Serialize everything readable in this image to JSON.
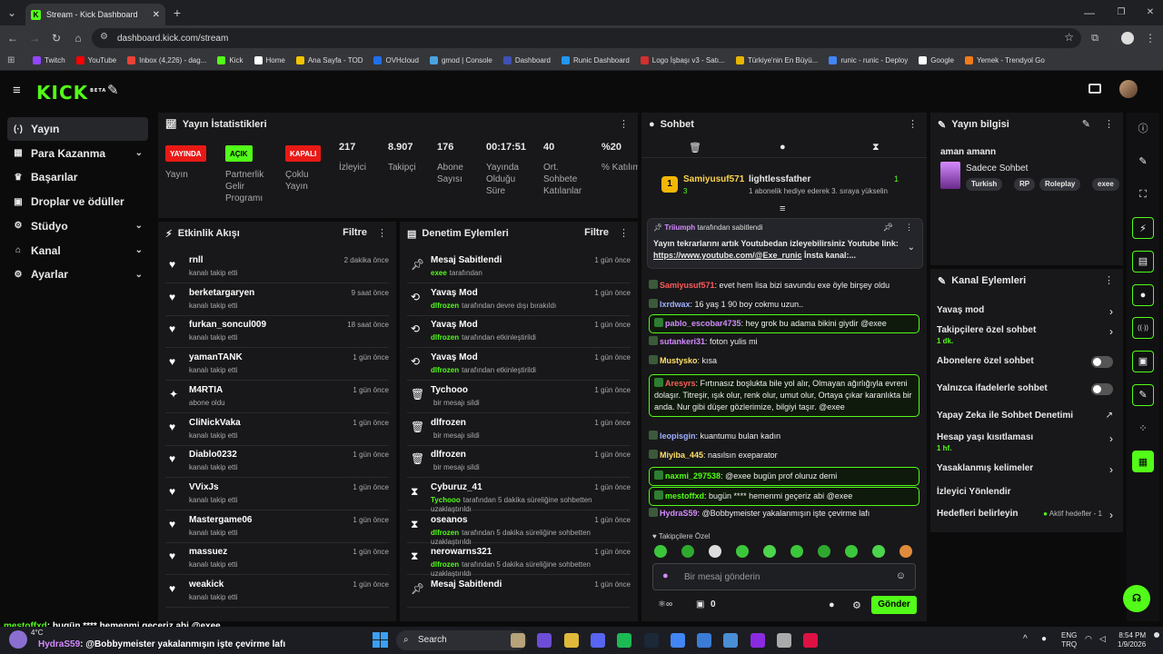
{
  "browser": {
    "tab_title": "Stream - Kick Dashboard",
    "url": "dashboard.kick.com/stream",
    "bookmarks": [
      "Twitch",
      "YouTube",
      "Inbox (4,226) - dag...",
      "Kick",
      "Home",
      "Ana Sayfa - TOD",
      "OVHcloud",
      "gmod | Console",
      "Dashboard",
      "Runic Dashboard",
      "Logo İşbaşı v3 - Satı...",
      "Türkiye'nin En Büyü...",
      "runic - runic - Deploy",
      "Google",
      "Yemek - Trendyol Go"
    ],
    "bookmark_colors": [
      "#9146ff",
      "#ff0000",
      "#ea4335",
      "#53fc18",
      "#ffffff",
      "#f5c400",
      "#1f6feb",
      "#4aa3df",
      "#3f51b5",
      "#2196f3",
      "#d32f2f",
      "#e8b600",
      "#4285f4",
      "#ffffff",
      "#f27a1a"
    ]
  },
  "header": {
    "logo": "KICK",
    "beta": "BETA"
  },
  "sidebar": {
    "items": [
      {
        "label": "Yayın",
        "icon": "stream-icon",
        "glyph": "(·)"
      },
      {
        "label": "Para Kazanma",
        "icon": "money-icon",
        "glyph": "▦"
      },
      {
        "label": "Başarılar",
        "icon": "trophy-icon",
        "glyph": "♛"
      },
      {
        "label": "Droplar ve ödüller",
        "icon": "gift-icon",
        "glyph": "▣"
      },
      {
        "label": "Stüdyo",
        "icon": "studio-icon",
        "glyph": "⚙"
      },
      {
        "label": "Kanal",
        "icon": "channel-icon",
        "glyph": "⌂"
      },
      {
        "label": "Ayarlar",
        "icon": "settings-icon",
        "glyph": "⚙"
      }
    ]
  },
  "stats": {
    "title": "Yayın İstatistikleri",
    "badges": [
      {
        "text": "YAYINDA",
        "label": "Yayın"
      },
      {
        "text": "AÇIK",
        "label": "Partnerlik Gelir Programı"
      },
      {
        "text": "KAPALI",
        "label": "Çoklu Yayın"
      }
    ],
    "items": [
      {
        "value": "217",
        "label": "İzleyici"
      },
      {
        "value": "8.907",
        "label": "Takipçi"
      },
      {
        "value": "176",
        "label": "Abone Sayısı"
      },
      {
        "value": "00:17:51",
        "label": "Yayında Olduğu Süre"
      },
      {
        "value": "40",
        "label": "Ort. Sohbete Katılanlar"
      },
      {
        "value": "%20",
        "label": "% Katılım"
      }
    ]
  },
  "activity": {
    "title": "Etkinlik Akışı",
    "filter": "Filtre",
    "items": [
      {
        "name": "rnll",
        "sub": "kanalı takip etti",
        "time": "2 dakika önce"
      },
      {
        "name": "berketargaryen",
        "sub": "kanalı takip etti",
        "time": "9 saat önce"
      },
      {
        "name": "furkan_soncul009",
        "sub": "kanalı takip etti",
        "time": "18 saat önce"
      },
      {
        "name": "yamanTANK",
        "sub": "kanalı takip etti",
        "time": "1 gün önce"
      },
      {
        "name": "M4RTIA",
        "sub": "abone oldu",
        "time": "1 gün önce"
      },
      {
        "name": "CliNickVaka",
        "sub": "kanalı takip etti",
        "time": "1 gün önce"
      },
      {
        "name": "Diablo0232",
        "sub": "kanalı takip etti",
        "time": "1 gün önce"
      },
      {
        "name": "VVixJs",
        "sub": "kanalı takip etti",
        "time": "1 gün önce"
      },
      {
        "name": "Mastergame06",
        "sub": "kanalı takip etti",
        "time": "1 gün önce"
      },
      {
        "name": "massuez",
        "sub": "kanalı takip etti",
        "time": "1 gün önce"
      },
      {
        "name": "weakick",
        "sub": "kanalı takip etti",
        "time": "1 gün önce"
      }
    ]
  },
  "moderation": {
    "title": "Denetim Eylemleri",
    "filter": "Filtre",
    "items": [
      {
        "name": "Mesaj Sabitlendi",
        "who": "exee",
        "sub": "tarafından",
        "time": "1 gün önce"
      },
      {
        "name": "Yavaş Mod",
        "who": "dlfrozen",
        "sub": "tarafından devre dışı bırakıldı",
        "time": "1 gün önce"
      },
      {
        "name": "Yavaş Mod",
        "who": "dlfrozen",
        "sub": "tarafından etkinleştirildi",
        "time": "1 gün önce"
      },
      {
        "name": "Yavaş Mod",
        "who": "dlfrozen",
        "sub": "tarafından etkinleştirildi",
        "time": "1 gün önce"
      },
      {
        "name": "Tychooo",
        "who": "",
        "sub": "bir mesajı sildi",
        "time": "1 gün önce"
      },
      {
        "name": "dlfrozen",
        "who": "",
        "sub": "bir mesajı sildi",
        "time": "1 gün önce"
      },
      {
        "name": "dlfrozen",
        "who": "",
        "sub": "bir mesajı sildi",
        "time": "1 gün önce"
      },
      {
        "name": "Cyburuz_41",
        "who": "Tychooo",
        "sub": "tarafından 5 dakika süreliğine sohbetten uzaklaştırıldı",
        "time": "1 gün önce"
      },
      {
        "name": "oseanos",
        "who": "dlfrozen",
        "sub": "tarafından 5 dakika süreliğine sohbetten uzaklaştırıldı",
        "time": "1 gün önce"
      },
      {
        "name": "nerowarns321",
        "who": "dlfrozen",
        "sub": "tarafından 5 dakika süreliğine sohbetten uzaklaştırıldı",
        "time": "1 gün önce"
      },
      {
        "name": "Mesaj Sabitlendi",
        "who": "",
        "sub": "",
        "time": "1 gün önce"
      }
    ]
  },
  "chat": {
    "title": "Sohbet",
    "leader_left": "Samiyusuf571",
    "leader_left_count": "3",
    "leader_right": "lightlessfather",
    "leader_right_count": "1",
    "leader_right_sub": "1 abonelik hediye ederek 3. sıraya yükselin",
    "pinned_by": "Triiumph",
    "pinned_by_suffix": "tarafından sabitlendi",
    "pinned_text": "Yayın tekrarlarını artık Youtubedan izleyebilirsiniz Youtube link:",
    "pinned_link": "https://www.youtube.com/@Exe_runic",
    "pinned_tail": "İnsta kanal:...",
    "messages": [
      {
        "user": "Samiyusuf571",
        "color": "#ff5a5a",
        "text": "evet hem lisa bizi savundu exe öyle birşey oldu",
        "hl": false
      },
      {
        "user": "lxrdwax",
        "color": "#9fb0ff",
        "text": "16 yaş 1 90 boy cokmu uzun..",
        "hl": false
      },
      {
        "user": "pablo_escobar4735",
        "color": "#d58bff",
        "text": "hey grok bu adama bikini giydir @exee",
        "hl": true
      },
      {
        "user": "sutankeri31",
        "color": "#d58bff",
        "text": "foton yulis mi",
        "hl": false
      },
      {
        "user": "Mustysko",
        "color": "#ffe066",
        "text": "kısa",
        "hl": false
      },
      {
        "user": "Aresyrs",
        "color": "#ff5a5a",
        "text": "Fırtınasız boşlukta bile yol alır, Olmayan ağırlığıyla evreni dolaşır. Titreşir, ışık olur, renk olur, umut olur, Ortaya çıkar karanlıkta bir anda. Nur gibi düşer gözlerimize, bilgiyi taşır. @exee",
        "hl": true
      },
      {
        "user": "leopisgin",
        "color": "#9fb0ff",
        "text": "kuantumu bulan kadın",
        "hl": false
      },
      {
        "user": "Miyiba_445",
        "color": "#ffe066",
        "text": "nasılsın exeparator",
        "hl": false
      },
      {
        "user": "naxmi_297538",
        "color": "#53fc18",
        "text": "@exee bugün prof oluruz demi",
        "hl": true
      },
      {
        "user": "mestoffxd",
        "color": "#53fc18",
        "text": "bugün **** hemenmi geçeriz abi @exee",
        "hl": true
      },
      {
        "user": "HydraS59",
        "color": "#d58bff",
        "text": "@Bobbymeister yakalanmışın işte çevirme lafı",
        "hl": false
      }
    ],
    "emote_label": "Takipçilere Özel",
    "placeholder": "Bir mesaj gönderin",
    "send": "Gönder",
    "points": "0"
  },
  "stream_info": {
    "title": "Yayın bilgisi",
    "stream_title": "aman amann",
    "category": "Sadece Sohbet",
    "tags": [
      "Turkish",
      "RP",
      "Roleplay",
      "exee"
    ]
  },
  "channel_actions": {
    "title": "Kanal Eylemleri",
    "items": [
      {
        "label": "Yavaş mod",
        "sub": "",
        "control": "chevron"
      },
      {
        "label": "Takipçilere özel sohbet",
        "sub": "1 dk.",
        "control": "chevron"
      },
      {
        "label": "Abonelere özel sohbet",
        "sub": "",
        "control": "toggle"
      },
      {
        "label": "Yalnızca ifadelerle sohbet",
        "sub": "",
        "control": "toggle"
      },
      {
        "label": "Yapay Zeka ile Sohbet Denetimi",
        "sub": "",
        "control": "external"
      },
      {
        "label": "Hesap yaşı kısıtlaması",
        "sub": "1 hf.",
        "control": "chevron"
      },
      {
        "label": "Yasaklanmış kelimeler",
        "sub": "",
        "control": "chevron"
      },
      {
        "label": "İzleyici Yönlendir",
        "sub": "",
        "control": "none"
      },
      {
        "label": "Hedefleri belirleyin",
        "sub": "",
        "control": "goal",
        "status": "Aktif hedefler - 1"
      }
    ]
  },
  "overlay": {
    "line1_user": "mestoffxd",
    "line1_text": ": bugün **** hemenmi geçeriz abi @exee",
    "line2_user": "HydraS59",
    "line2_text": ": @Bobbymeister yakalanmışın işte çevirme lafı"
  },
  "taskbar": {
    "search": "Search",
    "weather": "4°C",
    "lang1": "ENG",
    "lang2": "TRQ",
    "time": "8:54 PM",
    "date": "1/9/2026"
  }
}
